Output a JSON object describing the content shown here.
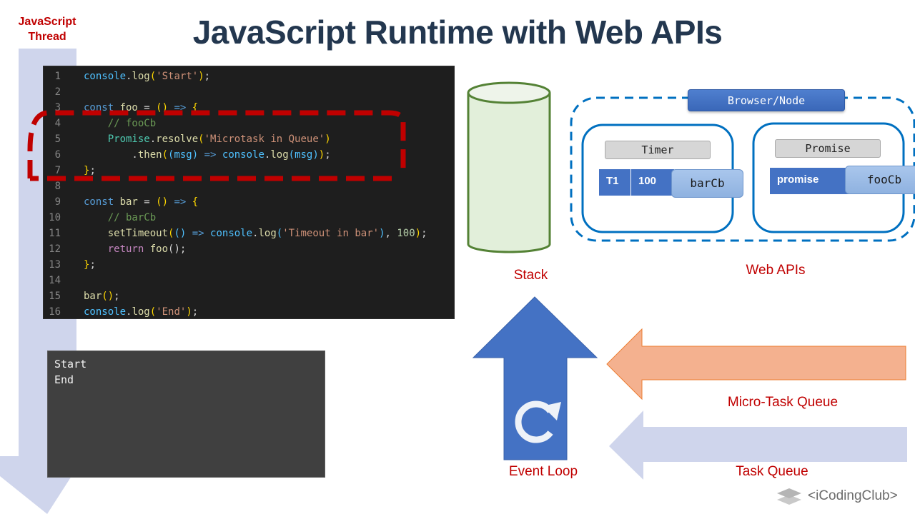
{
  "slide": {
    "title": "JavaScript Runtime with Web APIs",
    "thread_label_line1": "JavaScript",
    "thread_label_line2": "Thread"
  },
  "code_editor": {
    "lines": [
      {
        "num": "1",
        "tokens": [
          {
            "t": "console",
            "c": "t-call"
          },
          {
            "t": ".",
            "c": "t-plain"
          },
          {
            "t": "log",
            "c": "t-fn"
          },
          {
            "t": "(",
            "c": "t-punc"
          },
          {
            "t": "'Start'",
            "c": "t-str"
          },
          {
            "t": ")",
            "c": "t-punc"
          },
          {
            "t": ";",
            "c": "t-plain"
          }
        ]
      },
      {
        "num": "2",
        "tokens": []
      },
      {
        "num": "3",
        "tokens": [
          {
            "t": "const ",
            "c": "t-kw"
          },
          {
            "t": "foo",
            "c": "t-fn"
          },
          {
            "t": " = ",
            "c": "t-plain"
          },
          {
            "t": "()",
            "c": "t-punc"
          },
          {
            "t": " => ",
            "c": "t-kw"
          },
          {
            "t": "{",
            "c": "t-punc"
          }
        ]
      },
      {
        "num": "4",
        "tokens": [
          {
            "t": "    // fooCb",
            "c": "t-cm"
          }
        ]
      },
      {
        "num": "5",
        "tokens": [
          {
            "t": "    Promise",
            "c": "t-cls"
          },
          {
            "t": ".",
            "c": "t-plain"
          },
          {
            "t": "resolve",
            "c": "t-fn"
          },
          {
            "t": "(",
            "c": "t-punc"
          },
          {
            "t": "'Microtask in Queue'",
            "c": "t-str"
          },
          {
            "t": ")",
            "c": "t-punc"
          }
        ]
      },
      {
        "num": "6",
        "tokens": [
          {
            "t": "        .",
            "c": "t-plain"
          },
          {
            "t": "then",
            "c": "t-fn"
          },
          {
            "t": "(",
            "c": "t-punc"
          },
          {
            "t": "(msg)",
            "c": "t-call"
          },
          {
            "t": " => ",
            "c": "t-kw"
          },
          {
            "t": "console",
            "c": "t-call"
          },
          {
            "t": ".",
            "c": "t-plain"
          },
          {
            "t": "log",
            "c": "t-fn"
          },
          {
            "t": "(msg)",
            "c": "t-call"
          },
          {
            "t": ")",
            "c": "t-punc"
          },
          {
            "t": ";",
            "c": "t-plain"
          }
        ]
      },
      {
        "num": "7",
        "tokens": [
          {
            "t": "}",
            "c": "t-punc"
          },
          {
            "t": ";",
            "c": "t-plain"
          }
        ]
      },
      {
        "num": "8",
        "tokens": []
      },
      {
        "num": "9",
        "tokens": [
          {
            "t": "const ",
            "c": "t-kw"
          },
          {
            "t": "bar",
            "c": "t-fn"
          },
          {
            "t": " = ",
            "c": "t-plain"
          },
          {
            "t": "()",
            "c": "t-punc"
          },
          {
            "t": " => ",
            "c": "t-kw"
          },
          {
            "t": "{",
            "c": "t-punc"
          }
        ]
      },
      {
        "num": "10",
        "tokens": [
          {
            "t": "    // barCb",
            "c": "t-cm"
          }
        ]
      },
      {
        "num": "11",
        "tokens": [
          {
            "t": "    setTimeout",
            "c": "t-fn"
          },
          {
            "t": "(",
            "c": "t-punc"
          },
          {
            "t": "()",
            "c": "t-call"
          },
          {
            "t": " => ",
            "c": "t-kw"
          },
          {
            "t": "console",
            "c": "t-call"
          },
          {
            "t": ".",
            "c": "t-plain"
          },
          {
            "t": "log",
            "c": "t-fn"
          },
          {
            "t": "(",
            "c": "t-call"
          },
          {
            "t": "'Timeout in bar'",
            "c": "t-str"
          },
          {
            "t": ")",
            "c": "t-call"
          },
          {
            "t": ", ",
            "c": "t-plain"
          },
          {
            "t": "100",
            "c": "t-num"
          },
          {
            "t": ")",
            "c": "t-punc"
          },
          {
            "t": ";",
            "c": "t-plain"
          }
        ]
      },
      {
        "num": "12",
        "tokens": [
          {
            "t": "    return ",
            "c": "t-ret"
          },
          {
            "t": "foo",
            "c": "t-fn"
          },
          {
            "t": "()",
            "c": "t-plain"
          },
          {
            "t": ";",
            "c": "t-plain"
          }
        ]
      },
      {
        "num": "13",
        "tokens": [
          {
            "t": "}",
            "c": "t-punc"
          },
          {
            "t": ";",
            "c": "t-plain"
          }
        ]
      },
      {
        "num": "14",
        "tokens": []
      },
      {
        "num": "15",
        "tokens": [
          {
            "t": "bar",
            "c": "t-fn"
          },
          {
            "t": "()",
            "c": "t-punc"
          },
          {
            "t": ";",
            "c": "t-plain"
          }
        ]
      },
      {
        "num": "16",
        "tokens": [
          {
            "t": "console",
            "c": "t-call"
          },
          {
            "t": ".",
            "c": "t-plain"
          },
          {
            "t": "log",
            "c": "t-fn"
          },
          {
            "t": "(",
            "c": "t-punc"
          },
          {
            "t": "'End'",
            "c": "t-str"
          },
          {
            "t": ")",
            "c": "t-punc"
          },
          {
            "t": ";",
            "c": "t-plain"
          }
        ]
      }
    ],
    "highlighted_lines": "4-7"
  },
  "console_output": {
    "lines": [
      "Start",
      "End"
    ]
  },
  "stack": {
    "label": "Stack"
  },
  "web_apis": {
    "label": "Web APIs",
    "environment": "Browser/Node",
    "timer": {
      "title": "Timer",
      "id": "T1",
      "delay_ms": "100",
      "callback": "barCb"
    },
    "promise": {
      "title": "Promise",
      "name": "promise",
      "callback": "fooCb"
    }
  },
  "event_loop": {
    "label": "Event Loop",
    "icon": "refresh-icon"
  },
  "queues": {
    "microtask_label": "Micro-Task Queue",
    "task_label": "Task Queue"
  },
  "brand": {
    "name": "<iCodingClub>",
    "icon": "layers-icon"
  },
  "colors": {
    "title": "#23374f",
    "label_red": "#c00000",
    "thread_arrow": "#cfd5ec",
    "stack_fill": "#e2efda",
    "stack_stroke": "#548235",
    "webapi_blue": "#0070c0",
    "cell_blue": "#4472c4",
    "microtask_arrow": "#f4b18f",
    "task_arrow": "#cfd5ec",
    "highlight_dash": "#c00000"
  }
}
